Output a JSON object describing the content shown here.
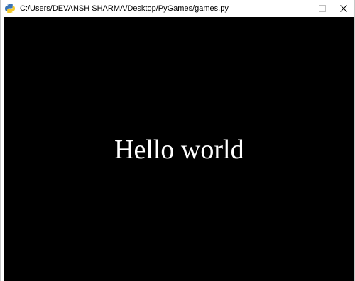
{
  "window": {
    "title": "C:/Users/DEVANSH SHARMA/Desktop/PyGames/games.py",
    "icon": "python-icon",
    "controls": {
      "minimize": "minimize-icon",
      "maximize": "maximize-icon",
      "close": "close-icon"
    }
  },
  "canvas": {
    "background": "#000000",
    "text": "Hello world",
    "text_color": "#ffffff"
  }
}
